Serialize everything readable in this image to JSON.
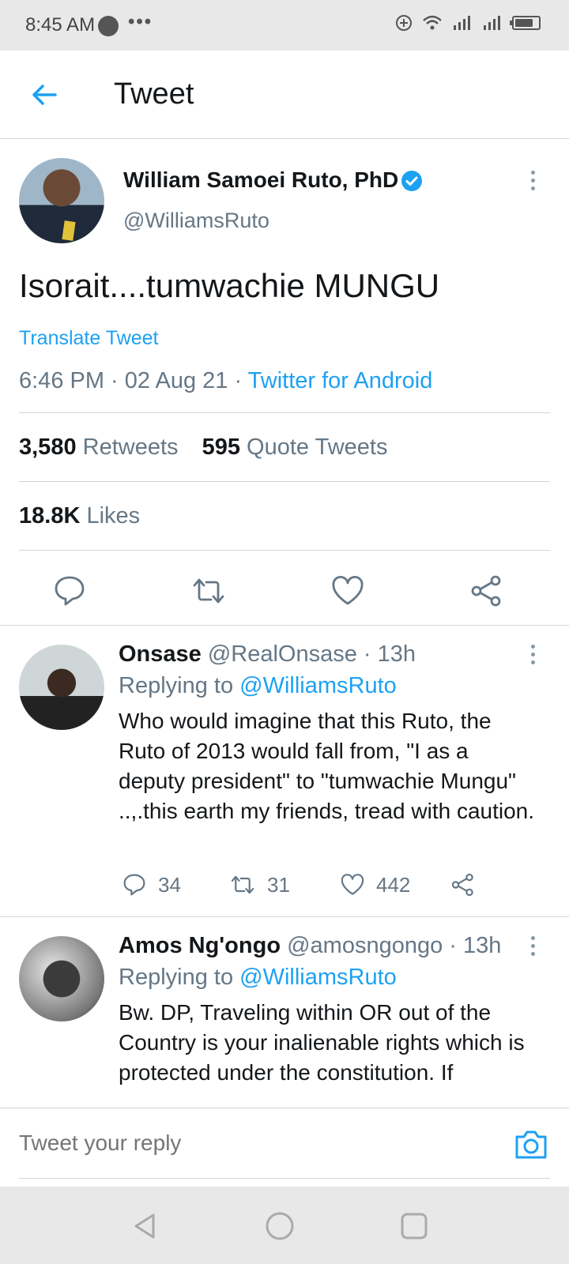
{
  "status_bar": {
    "time": "8:45 AM",
    "overflow": "•••"
  },
  "header": {
    "title": "Tweet"
  },
  "tweet": {
    "author_name": "William Samoei Ruto, PhD",
    "author_handle": "@WilliamsRuto",
    "text": "Isorait....tumwachie MUNGU",
    "translate_label": "Translate Tweet",
    "time_date": "6:46 PM · 02 Aug 21 · ",
    "source": "Twitter for Android",
    "retweets_count": "3,580",
    "retweets_label": "Retweets",
    "quotes_count": "595",
    "quotes_label": "Quote Tweets",
    "likes_count": "18.8K",
    "likes_label": "Likes"
  },
  "replies": [
    {
      "name": "Onsase",
      "handle_time": " @RealOnsase · 13h",
      "replying_prefix": "Replying to ",
      "replying_handle": "@WilliamsRuto",
      "text": "Who would imagine that this Ruto, the Ruto of 2013 would fall from, \"I as a deputy president\" to \"tumwachie Mungu\" ..,.this earth my friends, tread with caution.",
      "reply_count": "34",
      "retweet_count": "31",
      "like_count": "442"
    },
    {
      "name": "Amos Ng'ongo",
      "handle_time": " @amosngongo · 13h",
      "replying_prefix": "Replying to ",
      "replying_handle": "@WilliamsRuto",
      "text": "Bw. DP, Traveling within OR out of the Country is your inalienable rights which is protected under the constitution. If"
    }
  ],
  "reply_bar": {
    "placeholder": "Tweet your reply"
  },
  "colors": {
    "accent": "#1da1f2",
    "muted": "#657786",
    "divider": "#ccd6dd"
  },
  "icons": [
    "back-arrow-icon",
    "verified-icon",
    "more-icon",
    "reply-icon",
    "retweet-icon",
    "like-icon",
    "share-icon",
    "camera-icon",
    "nav-back-icon",
    "nav-home-icon",
    "nav-recents-icon"
  ]
}
